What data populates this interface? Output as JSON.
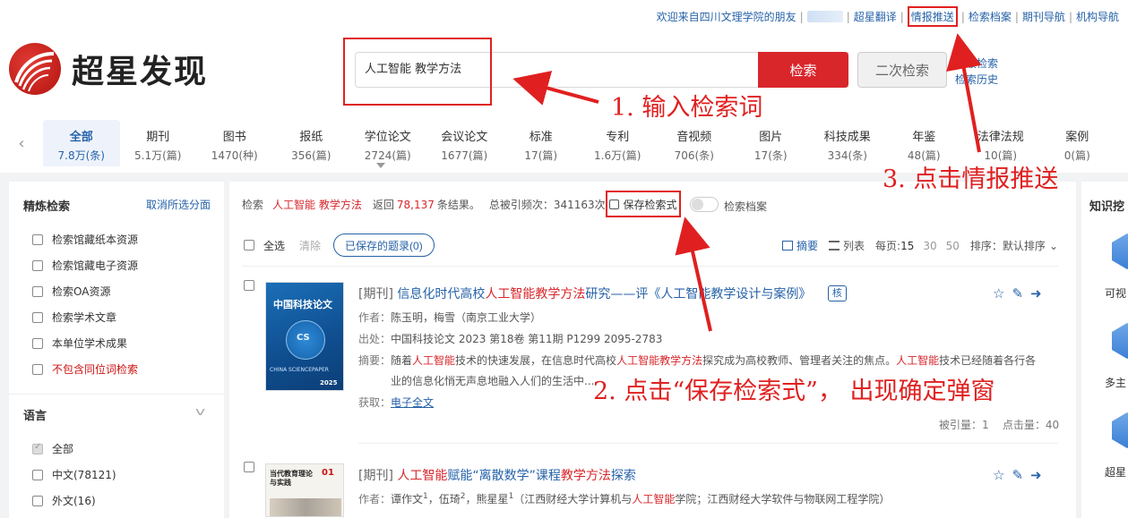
{
  "topbar": {
    "welcome": "欢迎来自四川文理学院的朋友",
    "links": [
      "超星翻译",
      "情报推送",
      "检索档案",
      "期刊导航",
      "机构导航"
    ]
  },
  "logo": {
    "text": "超星发现"
  },
  "search": {
    "value": "人工智能 教学方法",
    "button": "检索",
    "second_button": "二次检索",
    "advanced": "高级检索",
    "history": "检索历史"
  },
  "tabs": [
    {
      "label": "全部",
      "count": "7.8万(条)"
    },
    {
      "label": "期刊",
      "count": "5.1万(篇)"
    },
    {
      "label": "图书",
      "count": "1470(种)"
    },
    {
      "label": "报纸",
      "count": "356(篇)"
    },
    {
      "label": "学位论文",
      "count": "2724(篇)"
    },
    {
      "label": "会议论文",
      "count": "1677(篇)"
    },
    {
      "label": "标准",
      "count": "17(篇)"
    },
    {
      "label": "专利",
      "count": "1.6万(篇)"
    },
    {
      "label": "音视频",
      "count": "706(条)"
    },
    {
      "label": "图片",
      "count": "17(条)"
    },
    {
      "label": "科技成果",
      "count": "334(条)"
    },
    {
      "label": "年鉴",
      "count": "48(篇)"
    },
    {
      "label": "法律法规",
      "count": "10(篇)"
    },
    {
      "label": "案例",
      "count": "0(篇)"
    }
  ],
  "sidebar": {
    "title": "精炼检索",
    "clear": "取消所选分面",
    "items": [
      "检索馆藏纸本资源",
      "检索馆藏电子资源",
      "检索OA资源",
      "检索学术文章",
      "本单位学术成果",
      "不包含同位词检索"
    ],
    "lang_title": "语言",
    "lang_items": [
      "全部",
      "中文(78121)",
      "外文(16)"
    ]
  },
  "main": {
    "summary_prefix": "检索",
    "keyword": "人工智能 教学方法",
    "returned": "返回",
    "total": "78,137",
    "unit": "条结果。",
    "cited": "总被引频次：341163次",
    "save": "保存检索式",
    "archive": "检索档案",
    "select_all": "全选",
    "clear": "清除",
    "saved": "已保存的题录(0)",
    "view_abstract": "摘要",
    "view_list": "列表",
    "per_page": "每页:",
    "pages": [
      "15",
      "30",
      "50"
    ],
    "sort": "排序：默认排序"
  },
  "records": [
    {
      "type": "[期刊]",
      "title_a": "信息化时代高校",
      "title_red": "人工智能教学方法",
      "title_b": "研究——评《人工智能教学设计与案例》",
      "badge": "核",
      "authors_label": "作者：",
      "authors": "陈玉明，梅雪（南京工业大学）",
      "source_label": "出处：",
      "source": "中国科技论文 2023 第18卷 第11期 P1299  2095-2783",
      "abstract_label": "摘要：",
      "abstract_a": "随着",
      "abstract_r1": "人工智能",
      "abstract_b": "技术的快速发展，在信息时代高校",
      "abstract_r2": "人工智能教学方法",
      "abstract_c": "探究成为高校教师、管理者关注的焦点。",
      "abstract_r3": "人工智能",
      "abstract_d": "技术已经随着各行各",
      "abstract_line2": "业的信息化悄无声息地融入人们的生活中...",
      "fulltext_label": "获取：",
      "fulltext": "电子全文",
      "cited": "被引量：1",
      "clicks": "点击量：40",
      "cover_title": "中国科技论文",
      "cover_cs": "CS",
      "cover_foot": "CHINA SCIENCEPAPER",
      "cover_year": "2025"
    },
    {
      "type": "[期刊]",
      "title_red": "人工智能",
      "title_a": "赋能“离散数学”课程",
      "title_red2": "教学方法",
      "title_b": "探索",
      "authors_label": "作者：",
      "author1": "谭作文",
      "author2": "伍琦",
      "author3": "熊星星",
      "aff_a": "（江西财经大学计算机与",
      "aff_r": "人工智能",
      "aff_b": "学院；江西财经大学软件与物联网工程学院）",
      "cover_title": "当代教育理论与实践",
      "cover_no": "01"
    }
  ],
  "right_panel": {
    "title": "知识挖",
    "labels": [
      "可视",
      "多主",
      "超星"
    ]
  },
  "annotations": {
    "step1": "1. 输入检索词",
    "step2": "2. 点击“保存检索式”， 出现确定弹窗",
    "step3": "3. 点击情报推送"
  },
  "colors": {
    "accent": "#2662a8",
    "brand_red": "#d8262b",
    "annotation_red": "#e02020"
  }
}
